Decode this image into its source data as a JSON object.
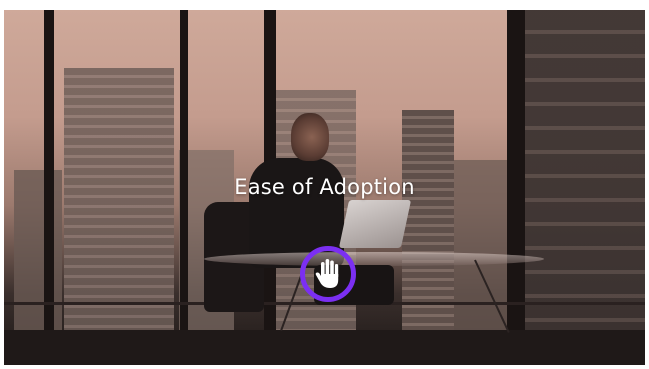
{
  "overlay": {
    "caption": "Ease of Adoption",
    "action_icon": "hand-icon",
    "accent_color": "#7b2ff2"
  }
}
